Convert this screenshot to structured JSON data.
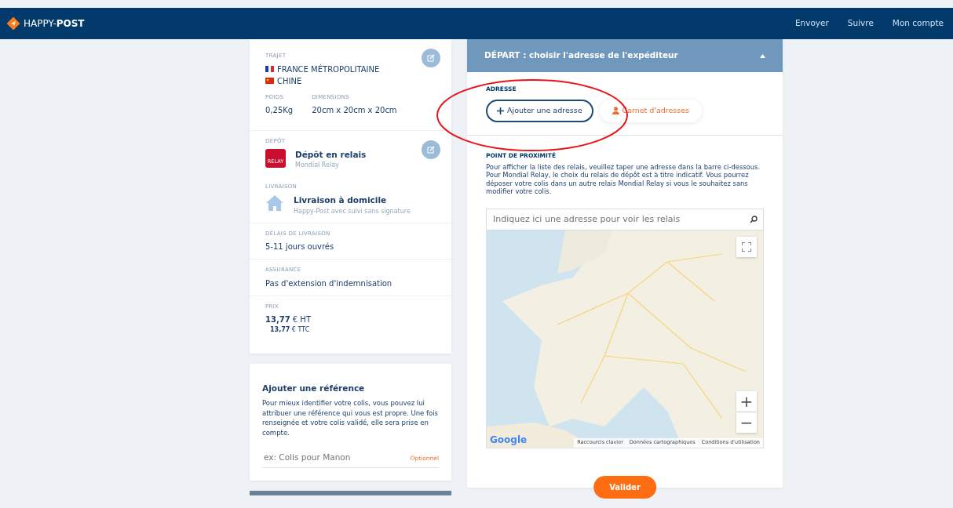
{
  "navbar": {
    "brand_light": "HAPPY-",
    "brand_bold": "POST",
    "links": [
      "Envoyer",
      "Suivre",
      "Mon compte"
    ]
  },
  "summary": {
    "trajet": {
      "label": "TRAJET",
      "countries": [
        {
          "kind": "france",
          "name": "FRANCE MÉTROPOLITAINE"
        },
        {
          "kind": "china",
          "name": "CHINE"
        }
      ],
      "poids_label": "POIDS",
      "poids": "0,25Kg",
      "dimensions_label": "DIMENSIONS",
      "dimensions": "20cm x 20cm x 20cm"
    },
    "depot": {
      "label": "DÉPÔT",
      "title": "Dépôt en relais",
      "subtitle": "Mondial Relay",
      "logo_text": "RELAY"
    },
    "livraison": {
      "label": "LIVRAISON",
      "title": "Livraison à domicile",
      "subtitle": "Happy-Post avec suivi sans signature"
    },
    "delais": {
      "label": "DÉLAIS DE LIVRAISON",
      "value": "5-11 jours ouvrés"
    },
    "assurance": {
      "label": "ASSURANCE",
      "value": "Pas d'extension d'indemnisation"
    },
    "prix": {
      "label": "PRIX",
      "lines": [
        "**13,77** € HT",
        "**13,77** € TTC"
      ]
    }
  },
  "reference": {
    "title": "Ajouter une référence",
    "text": "Pour mieux identifier votre colis, vous pouvez lui attribuer une référence qui vous est propre. Une fois renseignée et votre colis validé, elle sera prise en compte.",
    "placeholder": "ex: Colis pour Manon",
    "optional": "Optionnel"
  },
  "depart": {
    "title": "DÉPART : choisir l'adresse de l'expéditeur",
    "expanded": true,
    "adresse_label": "ADRESSE",
    "add_button": "Ajouter une adresse",
    "book_button": "Carnet d'adresses",
    "proximite_label": "POINT DE PROXIMITÉ",
    "proximite_text": "Pour afficher la liste des relais, veuillez taper une adresse dans la barre ci-dessous. Pour Mondial Relay, le choix du relais de dépôt est à titre indicatif. Vous pourrez déposer votre colis dans un autre relais Mondial Relay si vous le souhaitez sans modifier votre colis.",
    "search_placeholder": "Indiquez ici une adresse pour voir les relais",
    "map": {
      "zoom_in": "+",
      "zoom_out": "−",
      "logo": "Google",
      "attributions": [
        "Raccourcis clavier",
        "Données cartographiques",
        "Conditions d'utilisation"
      ]
    },
    "submit": "Valider"
  }
}
